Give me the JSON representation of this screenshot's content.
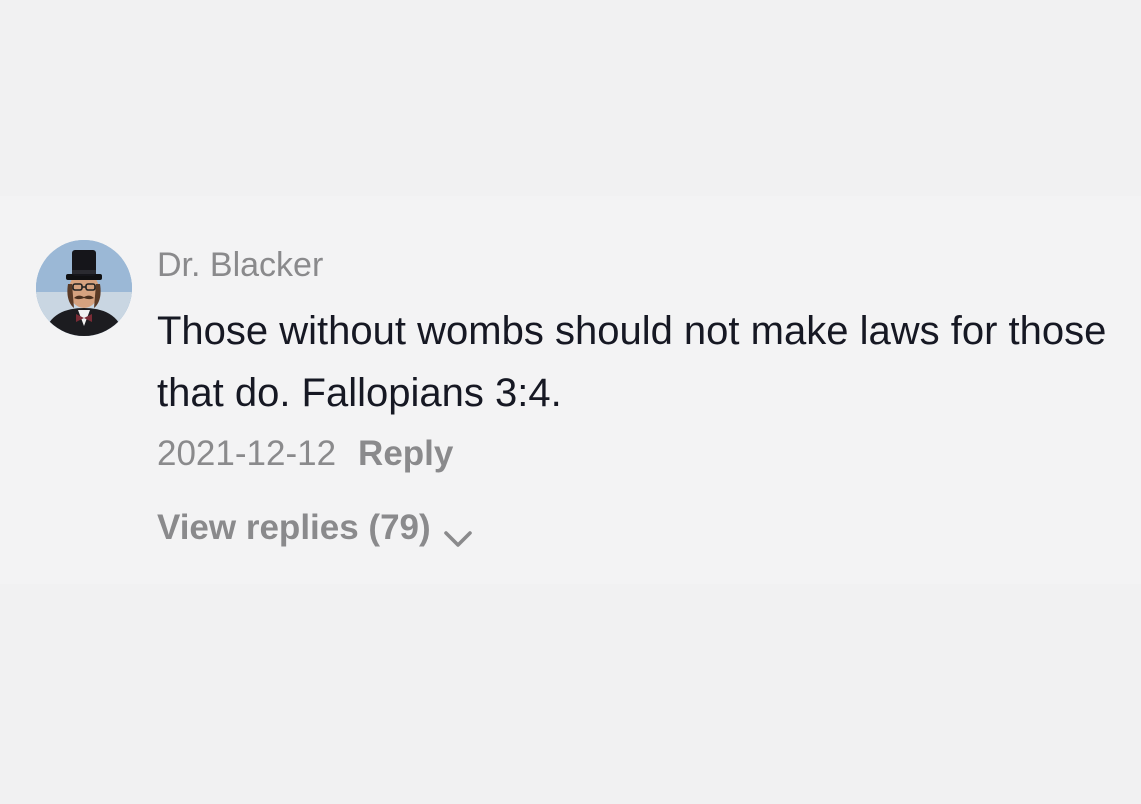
{
  "comment": {
    "avatar_icon": "user-avatar-top-hat",
    "username": "Dr. Blacker",
    "text": "Those without wombs should not make laws for those that do. Fallopians 3:4.",
    "date": "2021-12-12",
    "reply_label": "Reply",
    "view_replies_label": "View replies (79)",
    "chevron_icon": "chevron-down-icon"
  },
  "colors": {
    "background": "#f1f1f2",
    "card": "#f3f3f4",
    "primary_text": "#161823",
    "secondary_text": "#8a8a8c"
  }
}
